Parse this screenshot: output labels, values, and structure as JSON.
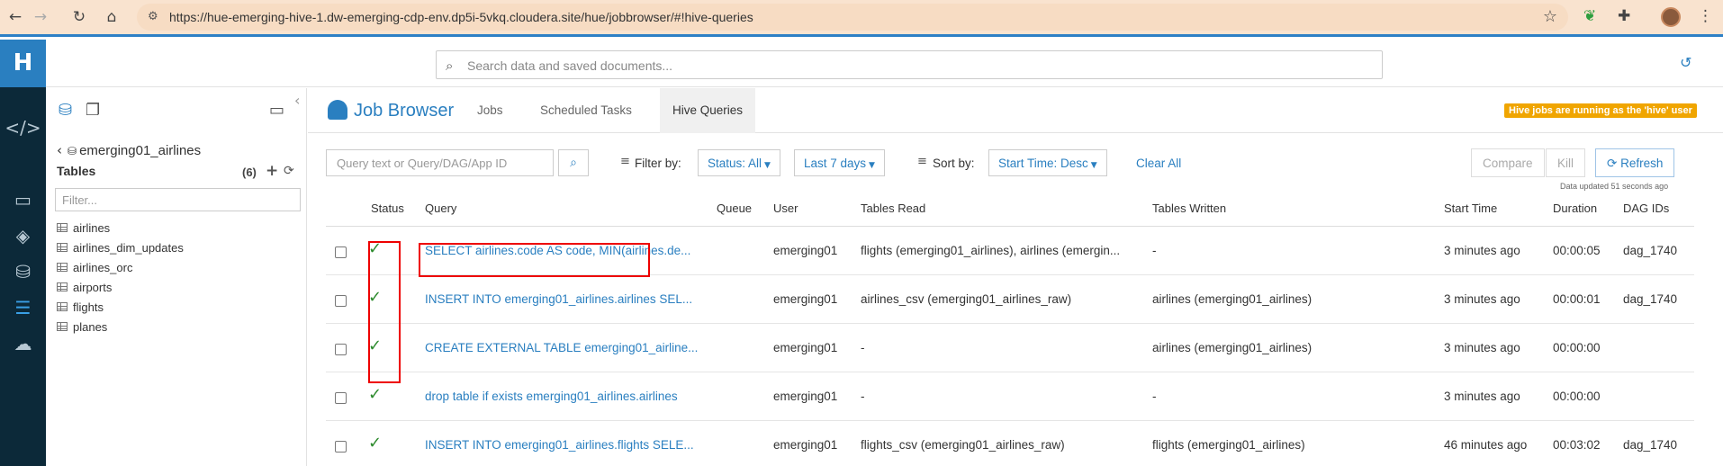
{
  "browser": {
    "url": "https://hue-emerging-hive-1.dw-emerging-cdp-env.dp5i-5vkq.cloudera.site/hue/jobbrowser/#!hive-queries"
  },
  "topbar": {
    "search_placeholder": "Search data and saved documents..."
  },
  "assist": {
    "database": "emerging01_airlines",
    "tables_heading": "Tables",
    "tables_count": "(6)",
    "filter_placeholder": "Filter...",
    "tables": [
      "airlines",
      "airlines_dim_updates",
      "airlines_orc",
      "airports",
      "flights",
      "planes"
    ]
  },
  "app": {
    "title": "Job Browser",
    "tabs": [
      "Jobs",
      "Scheduled Tasks",
      "Hive Queries"
    ],
    "active_tab": "Hive Queries",
    "hive_note": "Hive jobs are running as the 'hive' user"
  },
  "toolbar": {
    "query_placeholder": "Query text or Query/DAG/App ID",
    "filter_by": "Filter by:",
    "status_filter": "Status: All",
    "time_filter": "Last 7 days",
    "sort_by": "Sort by:",
    "sort_value": "Start Time: Desc",
    "clear_all": "Clear All",
    "compare": "Compare",
    "kill": "Kill",
    "refresh": "Refresh",
    "data_updated": "Data updated 51 seconds ago"
  },
  "table": {
    "headers": {
      "status": "Status",
      "query": "Query",
      "queue": "Queue",
      "user": "User",
      "tables_read": "Tables Read",
      "tables_written": "Tables Written",
      "start_time": "Start Time",
      "duration": "Duration",
      "dag_ids": "DAG IDs"
    },
    "rows": [
      {
        "status": "success",
        "query": "SELECT airlines.code AS code, MIN(airlines.de...",
        "queue": "",
        "user": "emerging01",
        "tables_read": "flights (emerging01_airlines), airlines (emergin...",
        "tables_written": "-",
        "start_time": "3 minutes ago",
        "duration": "00:00:05",
        "dag_ids": "dag_1740"
      },
      {
        "status": "success",
        "query": "INSERT INTO emerging01_airlines.airlines SEL...",
        "queue": "",
        "user": "emerging01",
        "tables_read": "airlines_csv (emerging01_airlines_raw)",
        "tables_written": "airlines (emerging01_airlines)",
        "start_time": "3 minutes ago",
        "duration": "00:00:01",
        "dag_ids": "dag_1740"
      },
      {
        "status": "success",
        "query": "CREATE EXTERNAL TABLE emerging01_airline...",
        "queue": "",
        "user": "emerging01",
        "tables_read": "-",
        "tables_written": "airlines (emerging01_airlines)",
        "start_time": "3 minutes ago",
        "duration": "00:00:00",
        "dag_ids": ""
      },
      {
        "status": "success",
        "query": "drop table if exists emerging01_airlines.airlines",
        "queue": "",
        "user": "emerging01",
        "tables_read": "-",
        "tables_written": "-",
        "start_time": "3 minutes ago",
        "duration": "00:00:00",
        "dag_ids": ""
      },
      {
        "status": "success",
        "query": "INSERT INTO emerging01_airlines.flights SELE...",
        "queue": "",
        "user": "emerging01",
        "tables_read": "flights_csv (emerging01_airlines_raw)",
        "tables_written": "flights (emerging01_airlines)",
        "start_time": "46 minutes ago",
        "duration": "00:03:02",
        "dag_ids": "dag_1740"
      }
    ]
  },
  "colors": {
    "accent": "#2a7fc0",
    "rail": "#0c2939",
    "success": "#2e8b2e",
    "highlight": "#e00000",
    "note": "#f0a500"
  }
}
